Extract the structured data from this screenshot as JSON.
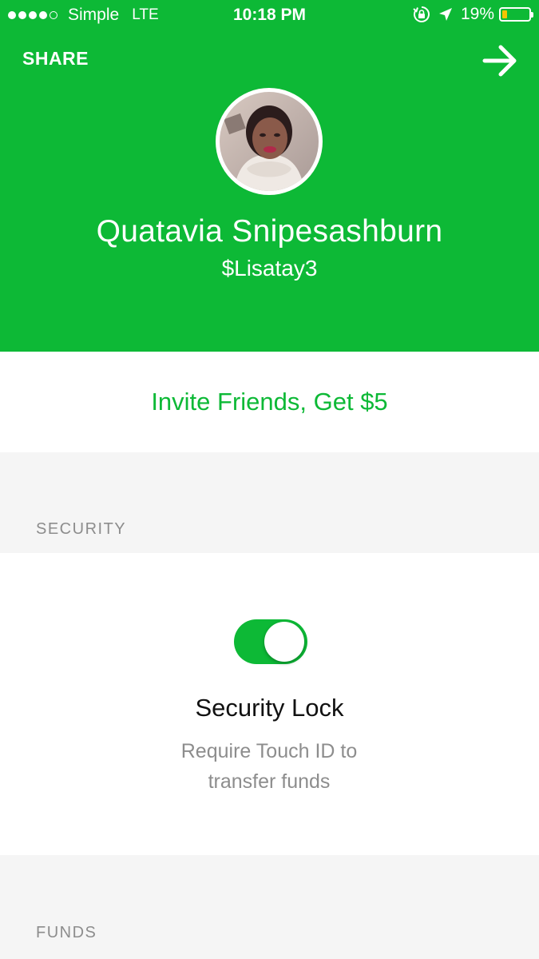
{
  "status_bar": {
    "carrier": "Simple",
    "network": "LTE",
    "time": "10:18 PM",
    "battery_percent": "19%",
    "battery_level": 0.19,
    "signal_bars_filled": 4,
    "signal_bars_total": 5
  },
  "header": {
    "share_label": "SHARE",
    "forward_icon": "arrow-right-icon",
    "name": "Quatavia Snipesashburn",
    "cashtag": "$Lisatay3",
    "background_color": "#0db936"
  },
  "invite": {
    "label": "Invite Friends, Get $5"
  },
  "security": {
    "section_label": "SECURITY",
    "toggle_on": true,
    "title": "Security Lock",
    "description": "Require Touch ID to transfer funds"
  },
  "funds": {
    "section_label": "FUNDS"
  },
  "colors": {
    "accent": "#0db936",
    "secondary_text": "#8d8d8d",
    "page_background": "#f5f5f5"
  }
}
